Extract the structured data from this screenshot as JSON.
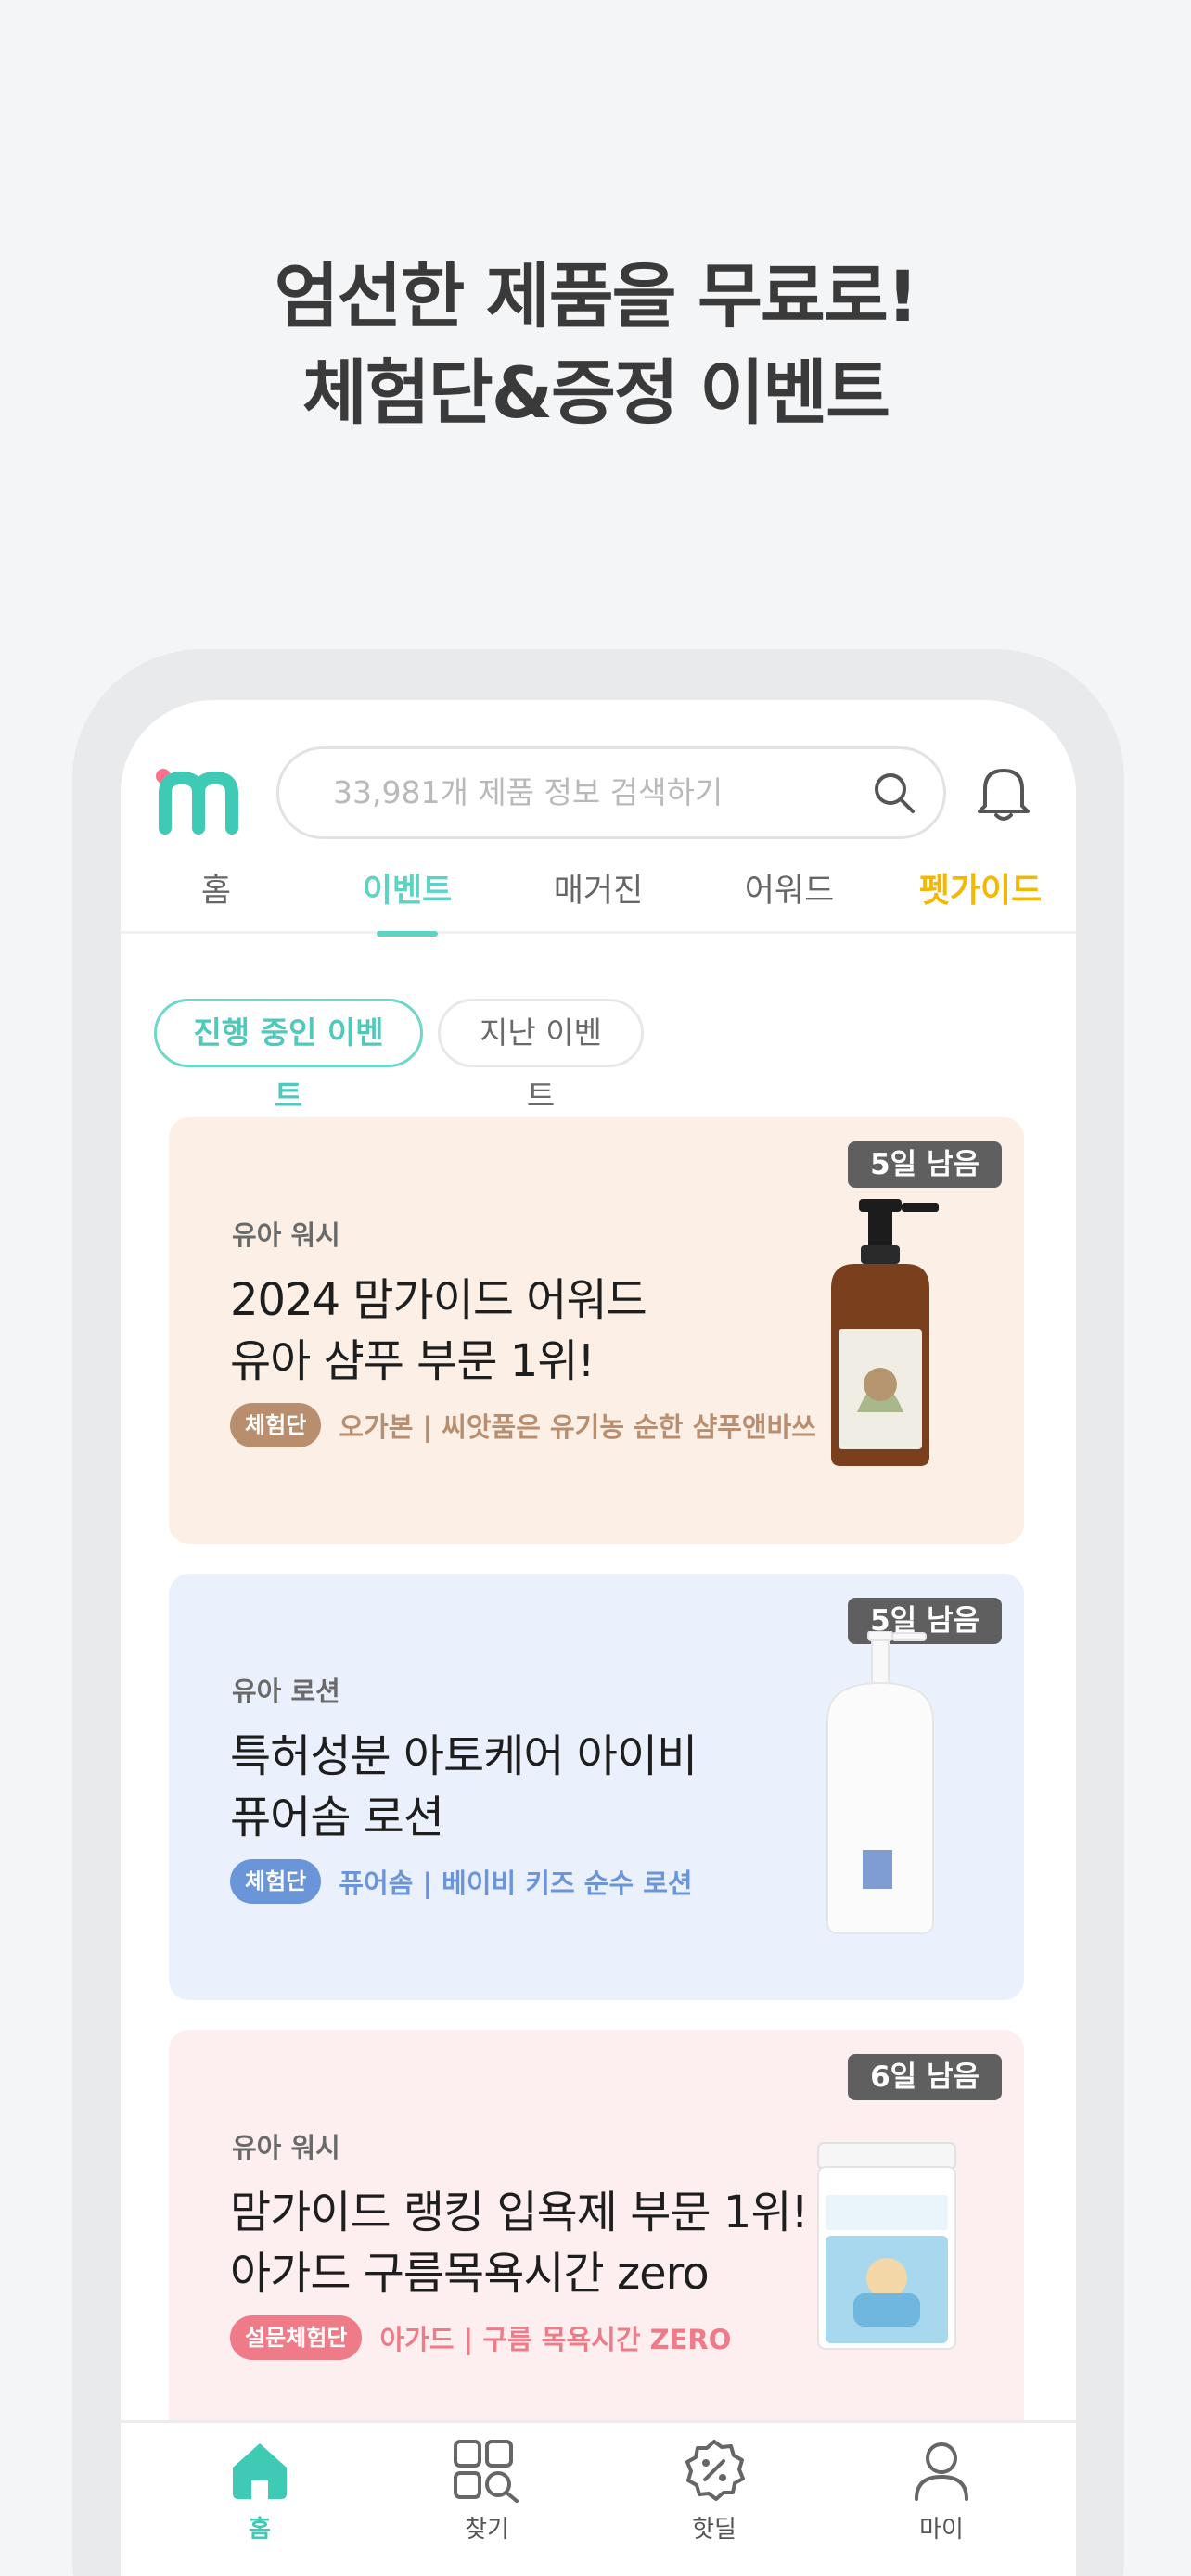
{
  "promo": {
    "line1": "엄선한 제품을 무료로!",
    "line2": "체험단&증정 이벤트"
  },
  "header": {
    "logo_text": "m",
    "search_placeholder": "33,981개 제품 정보 검색하기"
  },
  "tabs": [
    {
      "label": "홈"
    },
    {
      "label": "이벤트",
      "active": true
    },
    {
      "label": "매거진"
    },
    {
      "label": "어워드"
    },
    {
      "label": "펫가이드"
    }
  ],
  "filters": {
    "active": "진행 중인 이벤트",
    "inactive": "지난 이벤트"
  },
  "events": [
    {
      "badge": "5일 남음",
      "category": "유아 워시",
      "title_line1": "2024 맘가이드 어워드",
      "title_line2": "유아 샴푸 부문 1위!",
      "tag": "체험단",
      "brand_product": "오가본 | 씨앗품은 유기농 순한 샴푸앤바쓰",
      "bg_color": "#fbefe6",
      "tag_color": "#b88e6e",
      "brand_color": "#b88e6e"
    },
    {
      "badge": "5일 남음",
      "category": "유아 로션",
      "title_line1": "특허성분 아토케어 아이비",
      "title_line2": "퓨어솜 로션",
      "tag": "체험단",
      "brand_product": "퓨어솜 | 베이비 키즈 순수 로션",
      "bg_color": "#eaf1fd",
      "tag_color": "#6a95d8",
      "brand_color": "#6a95d8"
    },
    {
      "badge": "6일 남음",
      "category": "유아 워시",
      "title_line1": "맘가이드 랭킹 입욕제 부문 1위!",
      "title_line2": "아가드 구름목욕시간 zero",
      "tag": "설문체험단",
      "brand_product": "아가드 | 구름 목욕시간 ZERO",
      "bg_color": "#fdeef0",
      "tag_color": "#ef7a88",
      "brand_color": "#ef7a88"
    }
  ],
  "bottom_nav": [
    {
      "label": "홈",
      "icon": "home-icon",
      "active": true
    },
    {
      "label": "찾기",
      "icon": "find-icon"
    },
    {
      "label": "핫딜",
      "icon": "discount-icon"
    },
    {
      "label": "마이",
      "icon": "person-icon"
    }
  ],
  "colors": {
    "accent": "#5ed3c3",
    "badge_bg": "#5f5f5f"
  }
}
